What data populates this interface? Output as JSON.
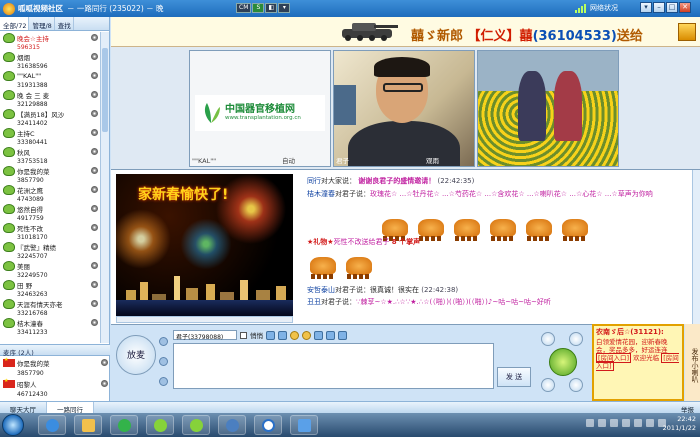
{
  "window": {
    "app_title": "呱呱视频社区",
    "room": "－ 一路同行 (235022) － 晚",
    "center_buttons": [
      "CM",
      "S",
      "◧",
      "▾"
    ],
    "network_label": "网络状况",
    "controls": [
      "▾",
      "–",
      "□",
      "✕"
    ]
  },
  "left_panel": {
    "tabs": [
      "全部/72",
      "管理/8",
      "查找"
    ],
    "users": [
      {
        "name": "晚会☆主持",
        "id": "596315",
        "host": true
      },
      {
        "name": "烟烟",
        "id": "31638596"
      },
      {
        "name": "\"\"KAL\"\"",
        "id": "31931388"
      },
      {
        "name": "晚 会 三 麦",
        "id": "32129888"
      },
      {
        "name": "【满员18】风沙",
        "id": "32411402"
      },
      {
        "name": "主持C",
        "id": "33380441"
      },
      {
        "name": "秋风",
        "id": "33753518"
      },
      {
        "name": "你是我的菜",
        "id": "3857790"
      },
      {
        "name": "花洲之鹰",
        "id": "4743089"
      },
      {
        "name": "悠然自得",
        "id": "4917759"
      },
      {
        "name": "死性不改",
        "id": "31018170"
      },
      {
        "name": "『武警』精绩",
        "id": "32245707"
      },
      {
        "name": "美丽",
        "id": "32249570"
      },
      {
        "name": "田 野",
        "id": "32463263"
      },
      {
        "name": "天涯有情天亦老",
        "id": "33216768"
      },
      {
        "name": "桔木潼春",
        "id": "33411233"
      }
    ],
    "section2_label": "麦序 (2人)",
    "section2_users": [
      {
        "name": "你是我的菜",
        "id": "3857790"
      },
      {
        "name": "昭黎人",
        "id": "46712430"
      }
    ]
  },
  "banner": {
    "gift_text_prefix": "囍ゞ新郎",
    "gift_name": "【仁义】囍",
    "gift_id": "(36104533)",
    "gift_suffix": "送给"
  },
  "videos": {
    "v1_logo_cn": "中国器官移植网",
    "v1_logo_url": "www.transplantation.org.cn",
    "v1_caption": "\"\"KAL\"\"",
    "v1_status": "自动",
    "v2_caption": "君子",
    "v2_status": "观雨"
  },
  "chat": {
    "fireworks_text": "家新春愉快了!",
    "messages": [
      {
        "who": "同行",
        "to": "对大家说：",
        "text": "谢谢良君子的盛情邀请！",
        "time": "(22:42:35)"
      },
      {
        "who": "桔木潼春",
        "to": "对君子说：",
        "text": "玫瑰花☆ ...☆牡丹花☆ ...☆芍药花☆ ...☆含欢花☆ ...☆喇叭花☆ ...☆心花☆ ...☆草声为你响"
      },
      {
        "who": "★礼物★",
        "to": "死性不改送给君子",
        "text": "8 个掌声"
      },
      {
        "who": "安哲泰山",
        "to": "对君子说：",
        "text": "很真诚！很实在",
        "time": "(22:42:38)"
      },
      {
        "who": "丑丑",
        "to": "对君子说：",
        "text": "∵棘莩~☆★.∴☆∵★.∴☆(（啪）)(（啪）)(（啪）)♪~咕~咕~咕~好听"
      }
    ]
  },
  "input": {
    "mic_label": "放麦",
    "target_select": "君子(33798088)",
    "private_label": "悄悄",
    "send_label": "发 送"
  },
  "ad": {
    "title": "农南ゞ后☆(31121):",
    "body": "白领爱情花园，迎新春晚会，奖品多多，好运连连",
    "link1": "[房间入口]",
    "link2": "[房间入口]",
    "welcome": "欢迎光临",
    "side_label": "发布小喇叭"
  },
  "bottom_tabs": [
    "聊天大厅",
    "一路同行"
  ],
  "report_label": "举报",
  "taskbar": {
    "time": "22:42",
    "date": "2011/1/22"
  }
}
